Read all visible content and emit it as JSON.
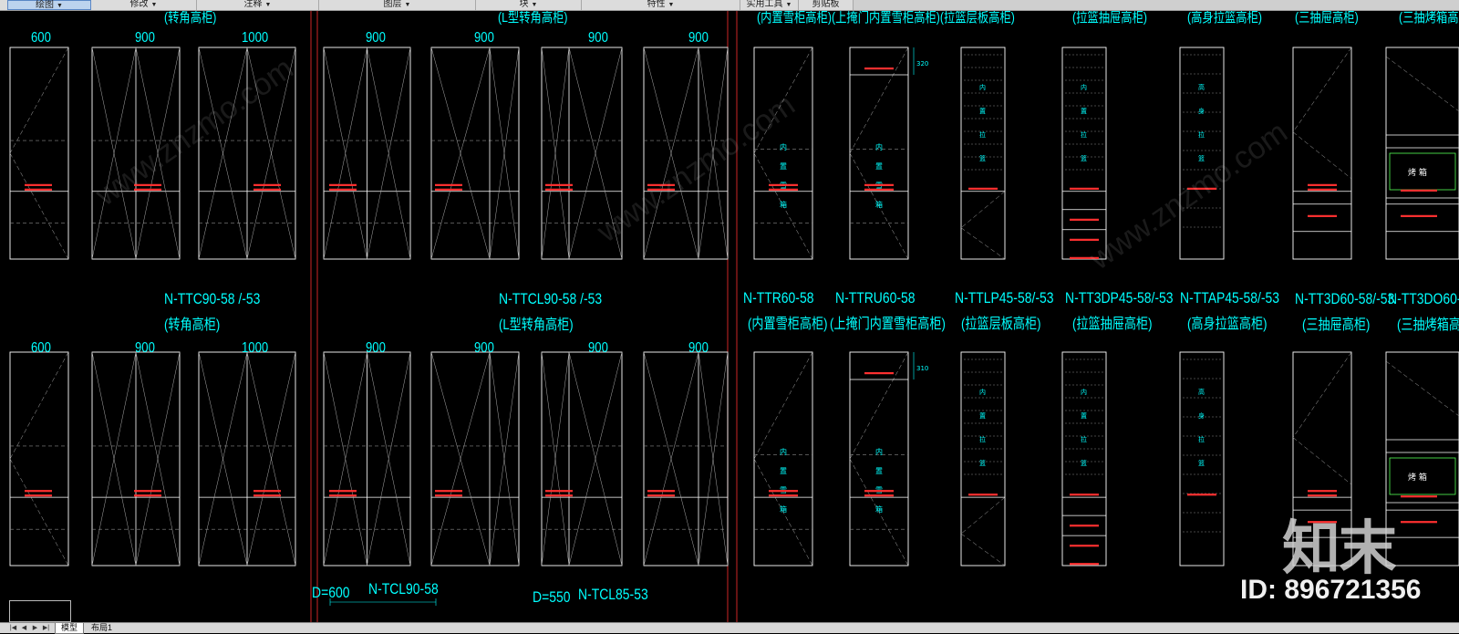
{
  "ribbon": {
    "panels": [
      {
        "label": "绘图",
        "name": "panel-draw"
      },
      {
        "label": "修改",
        "name": "panel-modify"
      },
      {
        "label": "注释",
        "name": "panel-annotate"
      },
      {
        "label": "图层",
        "name": "panel-layers"
      },
      {
        "label": "块",
        "name": "panel-block"
      },
      {
        "label": "特性",
        "name": "panel-properties"
      },
      {
        "label": "实用工具",
        "name": "panel-utilities"
      },
      {
        "label": "剪贴板",
        "name": "panel-clipboard"
      }
    ]
  },
  "drawing": {
    "top_captions": [
      "(转角高柜)",
      "(L型转角高柜)",
      "(内置雪柜高柜)(上掩门内置雪柜高柜)(拉篮层板高柜)",
      "(拉篮抽屉高柜)",
      "(高身拉篮高柜)",
      "(三抽屉高柜)",
      "(三抽烤箱高"
    ],
    "row_dims": [
      "600",
      "900",
      "1000",
      "900",
      "900",
      "900",
      "900"
    ],
    "groups": [
      {
        "code": "N-TTC90-58  /-53",
        "desc": "(转角高柜)"
      },
      {
        "code": "N-TTCL90-58  /-53",
        "desc": "(L型转角高柜)"
      },
      {
        "code": "N-TTR60-58",
        "desc": "(内置雪柜高柜)"
      },
      {
        "code": "N-TTRU60-58",
        "desc": "(上掩门内置雪柜高柜)"
      },
      {
        "code": "N-TTLP45-58/-53",
        "desc": "(拉篮层板高柜)"
      },
      {
        "code": "N-TT3DP45-58/-53",
        "desc": "(拉篮抽屉高柜)"
      },
      {
        "code": "N-TTAP45-58/-53",
        "desc": "(高身拉篮高柜)"
      },
      {
        "code": "N-TT3D60-58/-53",
        "desc": "(三抽屉高柜)"
      },
      {
        "code": "N-TT3DO60-",
        "desc": "(三抽烤箱高"
      }
    ],
    "dim_320": "320",
    "dim_310": "310",
    "inner_text_1": [
      "内",
      "置",
      "雪",
      "箱"
    ],
    "inner_text_2": [
      "内",
      "置",
      "拉",
      "篮"
    ],
    "inner_text_3": [
      "高",
      "身",
      "拉",
      "篮"
    ],
    "oven_text": "烤 箱",
    "bottom": {
      "d1": "D=600",
      "code1": "N-TCL90-58",
      "d2": "D=550",
      "code2": "N-TCL85-53"
    }
  },
  "watermark": {
    "site": "www.znzmo.com",
    "logo": "知末",
    "id_label": "ID: 896721356"
  },
  "layout_tabs": [
    "模型",
    "布局1"
  ],
  "colors": {
    "cyan": "#00ffff",
    "red": "#ff3030",
    "linework": "#ffffff",
    "background": "#000000"
  }
}
